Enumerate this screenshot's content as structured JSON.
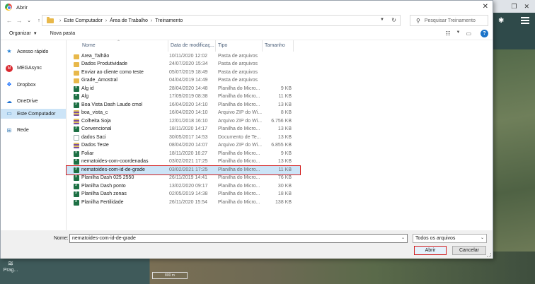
{
  "window": {
    "title": "Abrir",
    "close_glyph": "✕"
  },
  "address": {
    "crumbs": [
      "Este Computador",
      "Área de Trabalho",
      "Treinamento"
    ],
    "search_placeholder": "Pesquisar Treinamento"
  },
  "toolbar": {
    "organize": "Organizar",
    "new_folder": "Nova pasta"
  },
  "nav": {
    "items": [
      {
        "label": "Acesso rápido",
        "icon": "star-icon",
        "active": false
      },
      {
        "label": "MEGAsync",
        "icon": "mega-icon",
        "active": false
      },
      {
        "label": "Dropbox",
        "icon": "dropbox-icon",
        "active": false
      },
      {
        "label": "OneDrive",
        "icon": "cloud-icon",
        "active": false
      },
      {
        "label": "Este Computador",
        "icon": "computer-icon",
        "active": true
      },
      {
        "label": "Rede",
        "icon": "network-icon",
        "active": false
      }
    ]
  },
  "columns": {
    "name": "Nome",
    "date": "Data de modificaç...",
    "type": "Tipo",
    "size": "Tamanho"
  },
  "files": [
    {
      "name": "Area_Talhão",
      "date": "10/11/2020 12:02",
      "type": "Pasta de arquivos",
      "size": "",
      "kind": "folder"
    },
    {
      "name": "Dados Produtividade",
      "date": "24/07/2020 15:34",
      "type": "Pasta de arquivos",
      "size": "",
      "kind": "folder"
    },
    {
      "name": "Enviar ao cliente como teste",
      "date": "05/07/2019 18:49",
      "type": "Pasta de arquivos",
      "size": "",
      "kind": "folder"
    },
    {
      "name": "Grade_Amostral",
      "date": "04/04/2019 14:49",
      "type": "Pasta de arquivos",
      "size": "",
      "kind": "folder"
    },
    {
      "name": "Alg id",
      "date": "28/04/2020 14:48",
      "type": "Planilha do Micro...",
      "size": "9 KB",
      "kind": "excel"
    },
    {
      "name": "Alg",
      "date": "17/09/2019 08:38",
      "type": "Planilha do Micro...",
      "size": "11 KB",
      "kind": "excel"
    },
    {
      "name": "Boa Vista Dash Laudo cmol",
      "date": "16/04/2020 14:10",
      "type": "Planilha do Micro...",
      "size": "13 KB",
      "kind": "excel"
    },
    {
      "name": "boa_vista_c",
      "date": "16/04/2020 14:10",
      "type": "Arquivo ZIP do Wi...",
      "size": "8 KB",
      "kind": "zip"
    },
    {
      "name": "Colheita Soja",
      "date": "12/01/2018 16:10",
      "type": "Arquivo ZIP do Wi...",
      "size": "6.756 KB",
      "kind": "zip"
    },
    {
      "name": "Convencional",
      "date": "18/11/2020 14:17",
      "type": "Planilha do Micro...",
      "size": "13 KB",
      "kind": "excel"
    },
    {
      "name": "dados Saci",
      "date": "30/05/2017 14:53",
      "type": "Documento de Te...",
      "size": "13 KB",
      "kind": "doc"
    },
    {
      "name": "Dados Teste",
      "date": "08/04/2020 14:07",
      "type": "Arquivo ZIP do Wi...",
      "size": "6.855 KB",
      "kind": "zip"
    },
    {
      "name": "Foliar",
      "date": "18/11/2020 16:27",
      "type": "Planilha do Micro...",
      "size": "9 KB",
      "kind": "excel"
    },
    {
      "name": "nematoides-com-coordenadas",
      "date": "03/02/2021 17:25",
      "type": "Planilha do Micro...",
      "size": "13 KB",
      "kind": "excel"
    },
    {
      "name": "nematoides-com-id-de-grade",
      "date": "03/02/2021 17:25",
      "type": "Planilha do Micro...",
      "size": "11 KB",
      "kind": "excel",
      "selected": true
    },
    {
      "name": "Planilha Dash 025 2550",
      "date": "26/11/2019 14:41",
      "type": "Planilha do Micro...",
      "size": "76 KB",
      "kind": "excel"
    },
    {
      "name": "Planilha Dash ponto",
      "date": "13/02/2020 09:17",
      "type": "Planilha do Micro...",
      "size": "30 KB",
      "kind": "excel"
    },
    {
      "name": "Planilha Dash zonas",
      "date": "02/05/2019 14:38",
      "type": "Planilha do Micro...",
      "size": "18 KB",
      "kind": "excel"
    },
    {
      "name": "Planilha Fertilidade",
      "date": "26/11/2020 15:54",
      "type": "Planilha do Micro...",
      "size": "138 KB",
      "kind": "excel"
    }
  ],
  "footer": {
    "filename_label": "Nome:",
    "filename_value": "nematoides-com-id-de-grade",
    "filter_value": "Todos os arquivos",
    "open_label": "Abrir",
    "cancel_label": "Cancelar"
  },
  "background": {
    "side_label": "Prag...",
    "scale_label": "800 m"
  }
}
